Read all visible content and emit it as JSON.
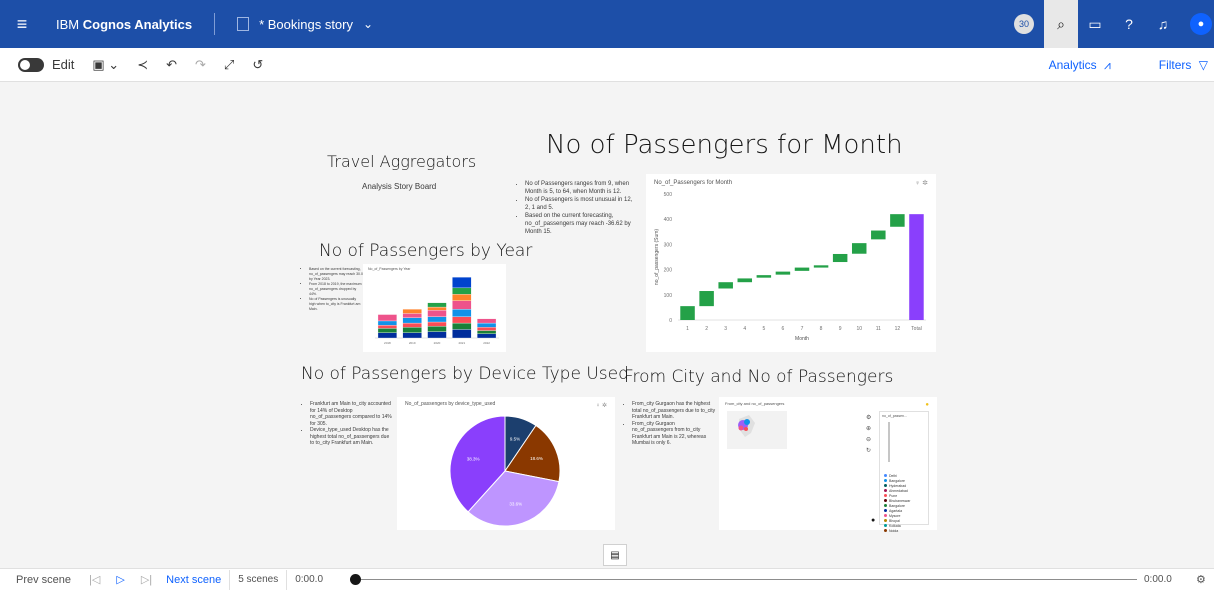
{
  "header": {
    "brand_prefix": "IBM ",
    "brand_name": "Cognos Analytics",
    "doc_title": "* Bookings story",
    "badge": "30",
    "menu_icon": "hamburger-icon",
    "right_icons": [
      "search-icon",
      "chat-icon",
      "help-icon",
      "bell-icon",
      "user-icon"
    ]
  },
  "toolbar": {
    "edit_label": "Edit",
    "analytics_label": "Analytics",
    "filters_label": "Filters"
  },
  "story": {
    "title": "Travel Aggregators",
    "subtitle": "Analysis Story Board"
  },
  "sections": {
    "month": {
      "heading": "No of Passengers for Month",
      "card_title": "No_of_Passengers for Month",
      "bullets": [
        "No of Passengers ranges from 9, when Month is 5, to 64, when Month is 12.",
        "No of Passengers is most unusual in 12, 2, 1 and 5.",
        "Based on the current forecasting, no_of_passengers may reach -36.62 by Month 15."
      ]
    },
    "year": {
      "heading": "No of Passengers by Year",
      "card_title": "No_of_Passengers by Year",
      "bullets": [
        "Based on the current forecasting, no_of_passengers may reach 30.0 by Year 2023.",
        "From 2018 to 2019, the maximum no_of_passengers dropped by 44%.",
        "No of Passengers is unusually high when to_city is Frankfurt am Main."
      ]
    },
    "device": {
      "heading": "No of Passengers by Device Type Used",
      "card_title": "No_of_passengers by device_type_used",
      "bullets": [
        "Frankfurt am Main to_city accounted for 14% of Desktop no_of_passengers compared to 14% for 305.",
        "Device_type_used Desktop has the highest total no_of_passengers due to to_city Frankfurt am Main."
      ]
    },
    "city": {
      "heading": "From City and No of Passengers",
      "card_title": "From_city and no_of_passengers",
      "bullets": [
        "From_city Gurgaon has the highest total no_of_passengers due to to_city Frankfurt am Main.",
        "From_city Gurgaon no_of_passengers from to_city Frankfurt am Main is 22, whereas Mumbai is only 6."
      ],
      "legend_header": "no_of_passen...",
      "legend": [
        "Delhi",
        "Bangalore",
        "Hyderabad",
        "Ahmedabad",
        "Pune",
        "Bhubaneswar",
        "Bangalore",
        "Agartala",
        "Mysore",
        "Bhopal",
        "Kolkata",
        "Noida"
      ],
      "legend_colors": [
        "#4589ff",
        "#1192e8",
        "#005d5d",
        "#9f1853",
        "#fa4d56",
        "#570408",
        "#198038",
        "#002d9c",
        "#ee538b",
        "#b28600",
        "#009d9a",
        "#8a3800"
      ]
    }
  },
  "chart_data": [
    {
      "type": "bar",
      "chart": "waterfall",
      "title": "No_of_Passengers for Month",
      "xlabel": "Month",
      "ylabel": "no_of_passengers (Sum)",
      "categories": [
        "1",
        "2",
        "3",
        "4",
        "5",
        "6",
        "7",
        "8",
        "9",
        "10",
        "11",
        "12",
        "Total"
      ],
      "ranges": [
        [
          0,
          55
        ],
        [
          55,
          115
        ],
        [
          125,
          150
        ],
        [
          150,
          165
        ],
        [
          168,
          178
        ],
        [
          180,
          192
        ],
        [
          195,
          208
        ],
        [
          208,
          217
        ],
        [
          230,
          262
        ],
        [
          263,
          305
        ],
        [
          320,
          355
        ],
        [
          370,
          420
        ],
        [
          0,
          420
        ]
      ],
      "ylim": [
        0,
        500
      ],
      "yticks": [
        0,
        100,
        200,
        300,
        400,
        500
      ],
      "colors": {
        "step": "#24a148",
        "total": "#8a3ffc"
      }
    },
    {
      "type": "pie",
      "title": "No_of_passengers by device_type_used",
      "labels": [
        "9.5%",
        "18.6%",
        "33.6%",
        "38.3%"
      ],
      "values": [
        9.5,
        18.6,
        33.6,
        38.3
      ],
      "colors": [
        "#1c3f6e",
        "#8a3800",
        "#be95ff",
        "#8a3ffc"
      ]
    },
    {
      "type": "bar",
      "chart": "stacked",
      "title": "No_of_Passengers by Year",
      "categories": [
        "2018",
        "2019",
        "2020",
        "2021",
        "2022"
      ],
      "series": [
        {
          "values": [
            5,
            5,
            6,
            8,
            4
          ],
          "color": "#002d9c"
        },
        {
          "values": [
            4,
            5,
            5,
            6,
            3
          ],
          "color": "#198038"
        },
        {
          "values": [
            3,
            4,
            4,
            6,
            3
          ],
          "color": "#fa4d56"
        },
        {
          "values": [
            4,
            5,
            5,
            7,
            4
          ],
          "color": "#1192e8"
        },
        {
          "values": [
            6,
            4,
            6,
            8,
            4
          ],
          "color": "#ee538b"
        },
        {
          "values": [
            0,
            4,
            3,
            6,
            0
          ],
          "color": "#ff832b"
        },
        {
          "values": [
            0,
            0,
            4,
            6,
            0
          ],
          "color": "#24a148"
        },
        {
          "values": [
            0,
            0,
            0,
            10,
            0
          ],
          "color": "#0043ce"
        }
      ],
      "ylim": [
        0,
        60
      ]
    }
  ],
  "footer": {
    "prev_label": "Prev scene",
    "next_label": "Next scene",
    "scenes_label": "5 scenes",
    "time_start": "0:00.0",
    "time_end": "0:00.0"
  }
}
